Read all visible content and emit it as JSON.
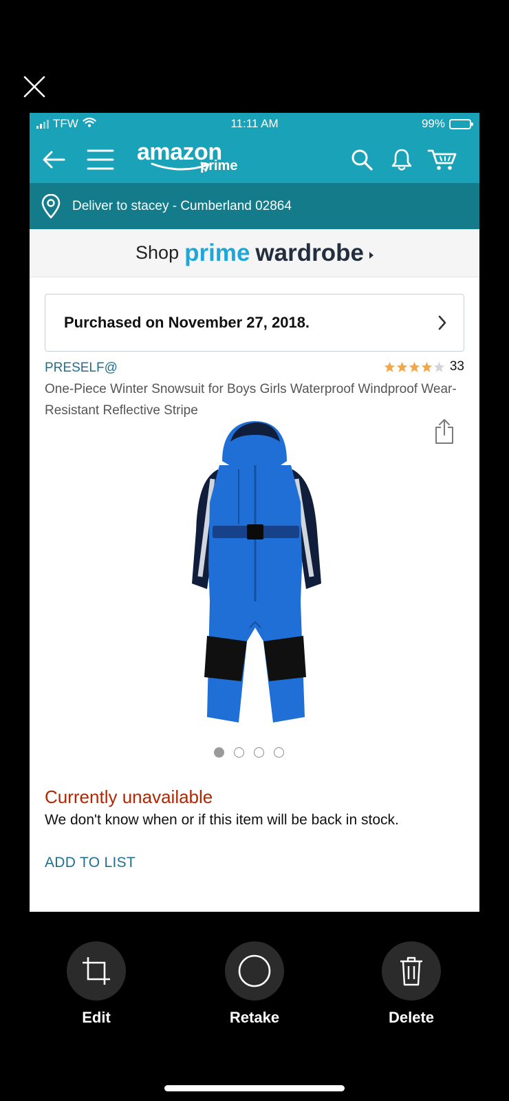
{
  "status": {
    "carrier": "TFW",
    "time": "11:11 AM",
    "battery": "99%",
    "battery_level": 0.99
  },
  "header": {
    "logo_word": "amazon",
    "logo_sub": "prime"
  },
  "delivery": {
    "text": "Deliver to stacey - Cumberland 02864"
  },
  "banner": {
    "shop": "Shop",
    "prime": "prime",
    "wardrobe": "wardrobe"
  },
  "order": {
    "purchased": "Purchased on November 27, 2018."
  },
  "product": {
    "brand": "PRESELF@",
    "rating": 4,
    "rating_max": 5,
    "review_count": "33",
    "title": "One-Piece Winter Snowsuit for Boys Girls Waterproof Windproof Wear-Resistant Reflective Stripe",
    "image_count": 4,
    "active_image": 1
  },
  "availability": {
    "status": "Currently unavailable",
    "message": "We don't know when or if this item will be back in stock."
  },
  "actions": {
    "add_to_list": "ADD TO LIST"
  },
  "camera": {
    "edit": "Edit",
    "retake": "Retake",
    "delete": "Delete"
  },
  "colors": {
    "header_teal": "#1aa3b8",
    "delivery_teal": "#137b8a",
    "prime_blue": "#1ea7d8",
    "link_blue": "#1f6f8b",
    "unavailable_red": "#b12704",
    "star_gold": "#f3a847"
  }
}
